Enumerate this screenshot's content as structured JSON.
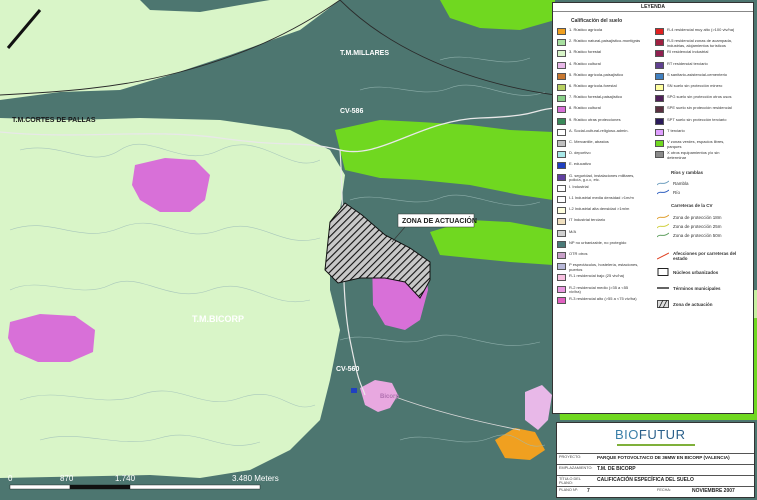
{
  "map_labels": {
    "tm_millares": "T.M.MILLARES",
    "tm_cortes": "T.M.CORTES DE PALLAS",
    "tm_bicorp": "T.M.BICORP",
    "cv_586": "CV-586",
    "cv_560": "CV-560",
    "zona_actuacion": "ZONA DE ACTUACIÓN",
    "town": "Bicorp"
  },
  "scale_bar": {
    "ticks": [
      "0",
      "870",
      "1.740",
      "3.480 Meters"
    ]
  },
  "legend": {
    "title": "LEYENDA",
    "subtitle": "Calificación del suelo",
    "left_items": [
      {
        "color": "#f0a020",
        "text": "1. Rústico agrícola"
      },
      {
        "color": "#a8e0a0",
        "text": "2. Rústico natural-paisajístico-montigrás"
      },
      {
        "color": "#d8f5c8",
        "text": "3. Rústico forestal"
      },
      {
        "color": "#e8b8e8",
        "text": "4. Rústico cultural"
      },
      {
        "color": "#c87830",
        "text": "5. Rústico agrícola-paisajístico"
      },
      {
        "color": "#b8d060",
        "text": "6. Rústico agrícola-forestal"
      },
      {
        "color": "#88d088",
        "text": "7. Rústico forestal-paisajístico"
      },
      {
        "color": "#d870d8",
        "text": "8. Rústico cultural"
      },
      {
        "color": "#3a8a5a",
        "text": "9. Rústico otras protecciones"
      },
      {
        "color": "#ffffff",
        "text": "A. Social-cultural-religioso-admin."
      },
      {
        "color": "#c0c0c0",
        "text": "C. Mercantile, abastos"
      },
      {
        "color": "#a8e8e8",
        "text": "D. deportivo"
      },
      {
        "color": "#2040c0",
        "text": "E. educativo"
      },
      {
        "color": "#6040a0",
        "text": "G. seguridad, instalaciones militares, policía, g.c.c, etc."
      },
      {
        "color": "#ffffff",
        "text": "I. Industrial"
      },
      {
        "color": "#ffffff",
        "text": "I-1 Industrial media densidad >1m/m"
      },
      {
        "color": "#ffffe0",
        "text": "I-2 Industrial alta densidad >1m/m"
      },
      {
        "color": "#f0e0c0",
        "text": "IT Industrial terciario"
      },
      {
        "color": "#d0d0d0",
        "text": "M/A"
      },
      {
        "color": "#4a7a78",
        "text": "NP no urbanizable, no protegido"
      },
      {
        "color": "#c8a0c8",
        "text": "OTR otros"
      },
      {
        "color": "#b8b8d8",
        "text": "P espectáculos, hostelería, estaciones, puertos"
      },
      {
        "color": "#f8c0e0",
        "text": "R-1 residencial bajo (25 viv/ha)"
      },
      {
        "color": "#e898e0",
        "text": "R-2 residencial medio (>35 a <55 viv/ha)"
      },
      {
        "color": "#e060c0",
        "text": "R-3 residencial alto (>55 a <75 viv/ha)"
      }
    ],
    "right_items": [
      {
        "color": "#e02020",
        "text": "R-4 residencial muy alto (>100 viv/ha)"
      },
      {
        "color": "#a02040",
        "text": "R-5 residencial zonas de acampada, industrias, alojamientos turísticos"
      },
      {
        "color": "#902050",
        "text": "RI residencial industrial"
      },
      {
        "color": "#604090",
        "text": "RT residencial terciario"
      },
      {
        "color": "#4080c0",
        "text": "S sanitario-asistencial-cementerio"
      },
      {
        "color": "#ffffa0",
        "text": "SN suelo sin protección minero"
      },
      {
        "color": "#50205a",
        "text": "SPG suelo sin protección otros usos"
      },
      {
        "color": "#5a3040",
        "text": "SPE suelo sin protección residencial"
      },
      {
        "color": "#2a1a5a",
        "text": "SPT suelo sin protección terciario"
      },
      {
        "color": "#e0a0ff",
        "text": "T terciario"
      },
      {
        "color": "#70d820",
        "text": "V zonas verdes, espacios libres, parques"
      },
      {
        "color": "#8a8a8a",
        "text": "X otros equipamientos y/o sin determinar"
      }
    ],
    "rios_title": "Ríos y ramblas",
    "rios": [
      {
        "color": "#70a0c0",
        "text": "Rambla"
      },
      {
        "color": "#3060c0",
        "text": "Río"
      }
    ],
    "carreteras_title": "Carreteras de la CV",
    "carreteras": [
      {
        "color": "#e0a030",
        "text": "Zona de protección 18m"
      },
      {
        "color": "#d0d040",
        "text": "Zona de protección 25m"
      },
      {
        "color": "#60a060",
        "text": "Zona de protección 50m"
      }
    ],
    "afecciones": "Afecciones por carreteras del estado",
    "nucleos": "Núcleos urbanizados",
    "terminos": "Términos municipales",
    "zona": "Zona de actuación"
  },
  "title_block": {
    "logo_a": "BIO",
    "logo_b": "FUTUR",
    "proyecto_key": "PROYECTO:",
    "proyecto": "PARQUE FOTOVOLTAICO DE 36MW EN BICORP (VALENCIA)",
    "emplazamiento_key": "EMPLAZAMIENTO:",
    "emplazamiento": "T.M. DE BICORP",
    "titulo_key": "TÍTULO DEL PLANO:",
    "titulo": "CALIFICACIÓN ESPECÍFICA DEL SUELO",
    "plano_key": "PLANO Nº:",
    "plano": "7",
    "fecha_key": "FECHA:",
    "fecha": "NOVIEMBRE 2007"
  },
  "colors": {
    "np_dark_teal": "#4d7670",
    "forestal_pale": "#d9f5c8",
    "verde": "#70d820",
    "cultural_pink": "#d870d8",
    "residencial_pink": "#e8a8e0",
    "agricola_orange": "#f0a020"
  }
}
